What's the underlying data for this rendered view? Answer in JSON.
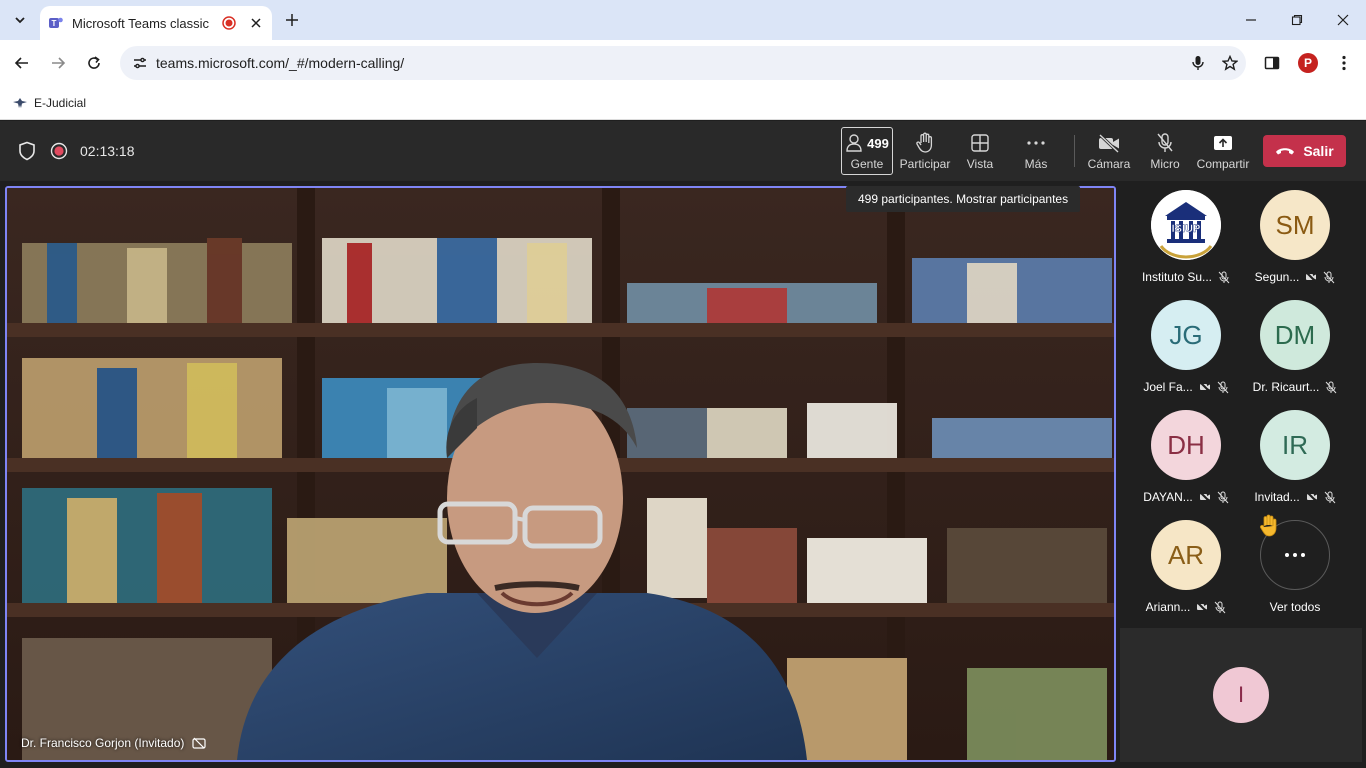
{
  "browser": {
    "tab_title": "Microsoft Teams classic",
    "url": "teams.microsoft.com/_#/modern-calling/",
    "bookmark_label": "E-Judicial",
    "profile_initial": "P"
  },
  "meeting": {
    "timer": "02:13:18",
    "controls": {
      "people_count": "499",
      "people_label": "Gente",
      "raise_label": "Participar",
      "view_label": "Vista",
      "more_label": "Más",
      "camera_label": "Cámara",
      "mic_label": "Micro",
      "share_label": "Compartir",
      "leave_label": "Salir"
    },
    "tooltip": "499 participantes. Mostrar participantes",
    "speaker_name": "Dr. Francisco Gorjon (Invitado)"
  },
  "roster": {
    "participants": [
      {
        "name": "Instituto Su...",
        "initials": "",
        "logo_text": "ISIUP",
        "bg": "#ffffff",
        "fg": "#1a2f7a"
      },
      {
        "name": "Segun...",
        "initials": "SM",
        "bg": "#f6e7c8",
        "fg": "#8a5a12"
      },
      {
        "name": "Joel Fa...",
        "initials": "JG",
        "bg": "#d6eef2",
        "fg": "#2a6c78"
      },
      {
        "name": "Dr. Ricaurt...",
        "initials": "DM",
        "bg": "#cfe9dc",
        "fg": "#2c6b4e"
      },
      {
        "name": "DAYAN...",
        "initials": "DH",
        "bg": "#f3d6dc",
        "fg": "#8a2f44"
      },
      {
        "name": "Invitad...",
        "initials": "IR",
        "bg": "#d3ebe1",
        "fg": "#2f6a55"
      },
      {
        "name": "Ariann...",
        "initials": "AR",
        "bg": "#f6e6c6",
        "fg": "#8a5e18"
      }
    ],
    "see_all_label": "Ver todos",
    "self_initial": "I"
  },
  "colors": {
    "accent": "#7f85f5",
    "leave": "#c4314b",
    "record": "#e04a5f"
  }
}
